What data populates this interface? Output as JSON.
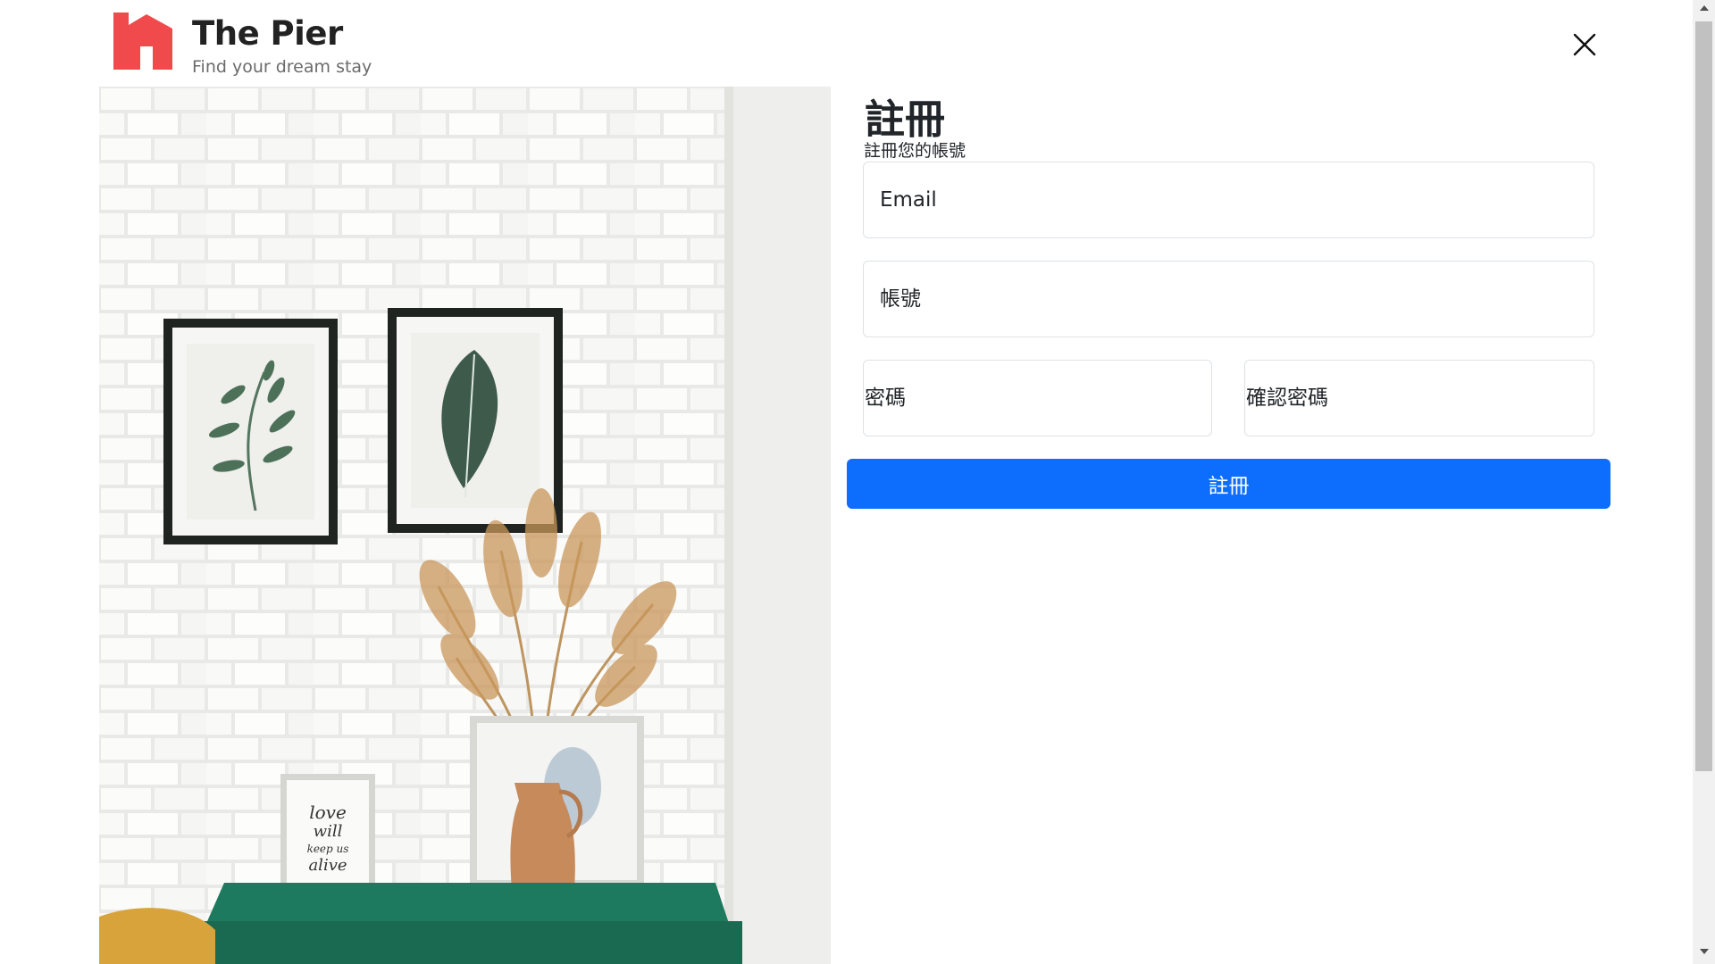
{
  "brand": {
    "title": "The Pier",
    "tagline": "Find your dream stay",
    "logo_icon": "house-logo-icon",
    "logo_color": "#f04a4d"
  },
  "header": {
    "close_icon": "close-icon"
  },
  "photo": {
    "description_icon": "interior-photo",
    "sign_text": [
      "love",
      "will",
      "keep us",
      "alive"
    ]
  },
  "form": {
    "title": "註冊",
    "subtitle": "註冊您的帳號",
    "email_placeholder": "Email",
    "account_placeholder": "帳號",
    "password_placeholder": "密碼",
    "confirm_placeholder": "確認密碼",
    "submit_label": "註冊",
    "accent_color": "#0d6efd"
  }
}
